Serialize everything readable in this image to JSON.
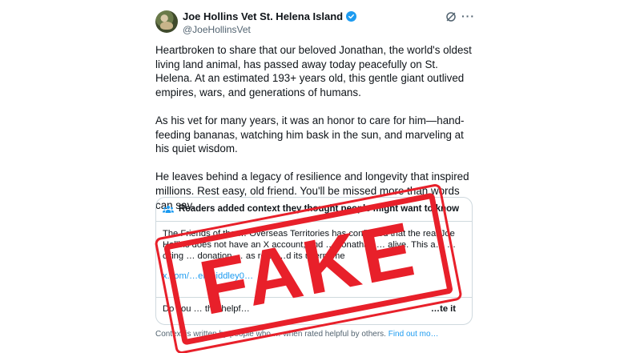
{
  "author": {
    "display_name": "Joe Hollins Vet St. Helena Island",
    "handle": "@JoeHollinsVet",
    "verified": true,
    "verified_color": "#1d9bf0"
  },
  "post": {
    "paragraphs": [
      "Heartbroken to share that our beloved Jonathan, the world's oldest living land animal, has passed away today peacefully on St. Helena. At an estimated 193+ years old, this gentle giant outlived empires, wars, and generations of humans.",
      "As his vet for many years, it was an honor to care for him—hand-feeding bananas, watching him bask in the sun, and marveling at his quiet wisdom.",
      "He leaves behind a legacy of resilience and longevity that inspired millions. Rest easy, old friend. You'll be missed more than words can say."
    ]
  },
  "community_note": {
    "header": "Readers added context they thought people might want to know",
    "text": "The Friends of the … Overseas Territories has confirmed that the real Joe Hollins does not have an X account, and … Jonathan … alive. This a… …citing … donation … as re… …d its username",
    "link": "x.com/…ertmiddley0…",
    "rate_question": "Do you … this helpf…",
    "rate_button": "…te it"
  },
  "footer": {
    "text": "Context is written by people who … when rated helpful by others.",
    "link": "Find out mo…"
  },
  "stamp": {
    "label": "FAKE",
    "color": "#e8202a"
  },
  "icons": {
    "grok": "grok-icon",
    "more": "more-options-icon",
    "people": "people-icon",
    "verified": "verified-badge-icon"
  }
}
